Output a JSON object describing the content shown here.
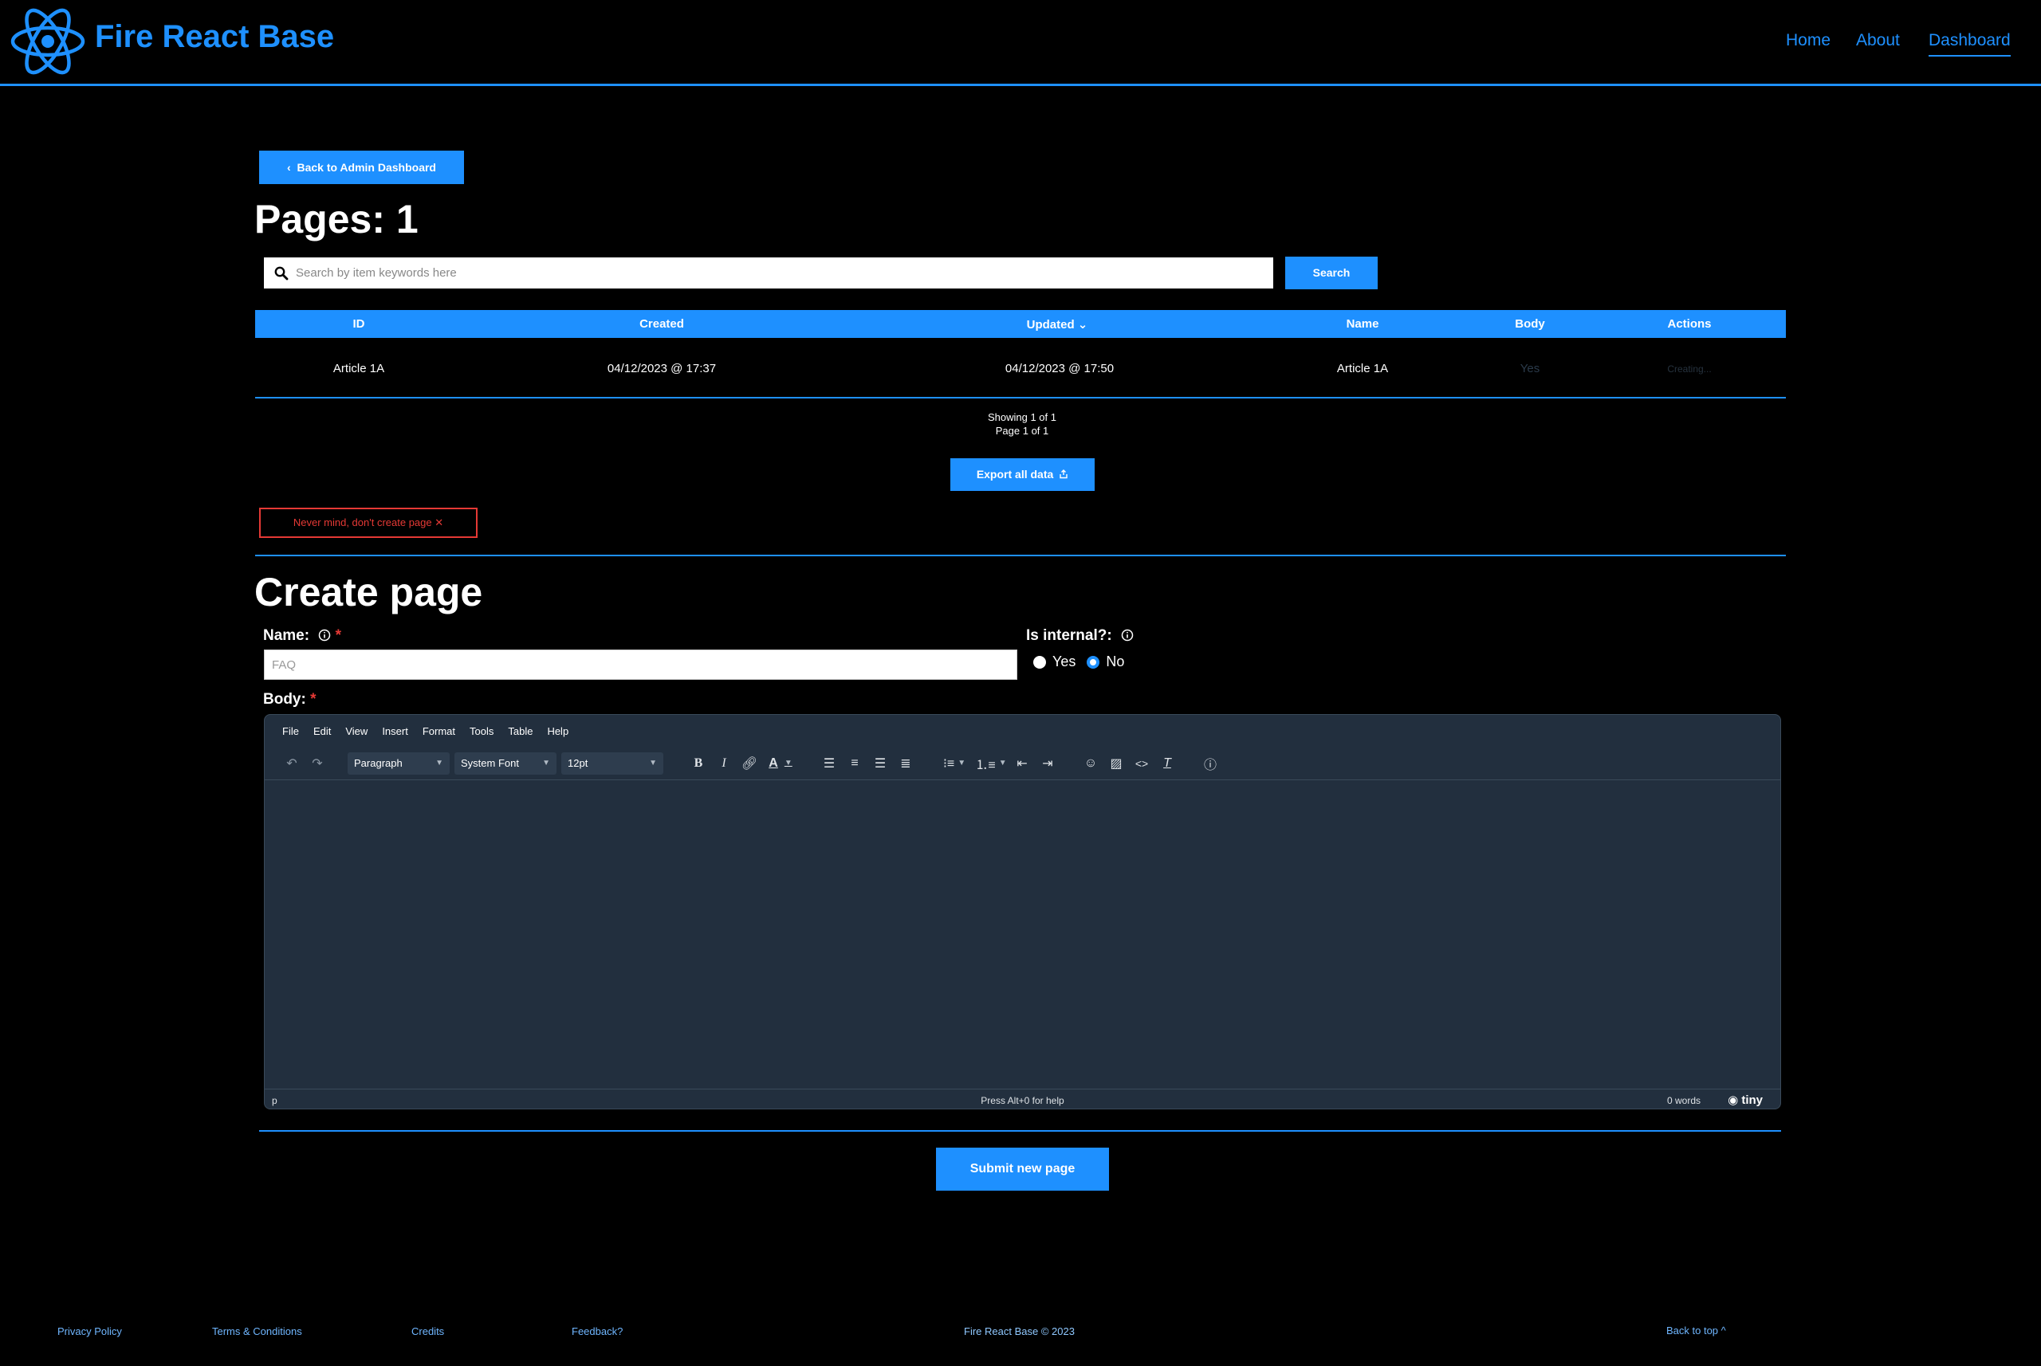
{
  "header": {
    "brand": "Fire React Base",
    "nav": {
      "home": "Home",
      "about": "About",
      "dashboard": "Dashboard"
    },
    "accent_color": "#1e90ff"
  },
  "main": {
    "back_button": "Back to Admin Dashboard",
    "title": "Pages: 1",
    "search": {
      "placeholder": "Search by item keywords here",
      "button": "Search"
    },
    "table": {
      "columns": [
        "ID",
        "Created",
        "Updated",
        "Name",
        "Body",
        "Actions"
      ],
      "sort_indicator": "⌄",
      "rows": [
        {
          "id": "Article 1A",
          "created": "04/12/2023 @ 17:37",
          "updated": "04/12/2023 @ 17:50",
          "name": "Article 1A",
          "body": "Yes",
          "actions": "Creating..."
        }
      ]
    },
    "pagination": {
      "showing": "Showing 1 of 1",
      "page": "Page 1 of 1"
    },
    "export_button": "Export all data",
    "cancel_button": "Never mind, don't create page"
  },
  "create_form": {
    "title": "Create page",
    "name_label": "Name:",
    "name_placeholder": "FAQ",
    "internal_label": "Is internal?:",
    "radio": {
      "yes": "Yes",
      "no": "No",
      "selected": "No"
    },
    "body_label": "Body:",
    "required_mark": "*",
    "editor": {
      "menu": [
        "File",
        "Edit",
        "View",
        "Insert",
        "Format",
        "Tools",
        "Table",
        "Help"
      ],
      "block_format": "Paragraph",
      "font_family": "System Font",
      "font_size": "12pt",
      "status_path": "p",
      "status_help": "Press Alt+0 for help",
      "word_count": "0 words",
      "brand": "tiny"
    },
    "submit_button": "Submit new page"
  },
  "footer": {
    "privacy": "Privacy Policy",
    "terms": "Terms & Conditions",
    "credits": "Credits",
    "feedback": "Feedback?",
    "copyright": "Fire React Base © 2023",
    "back_to_top": "Back to top"
  }
}
